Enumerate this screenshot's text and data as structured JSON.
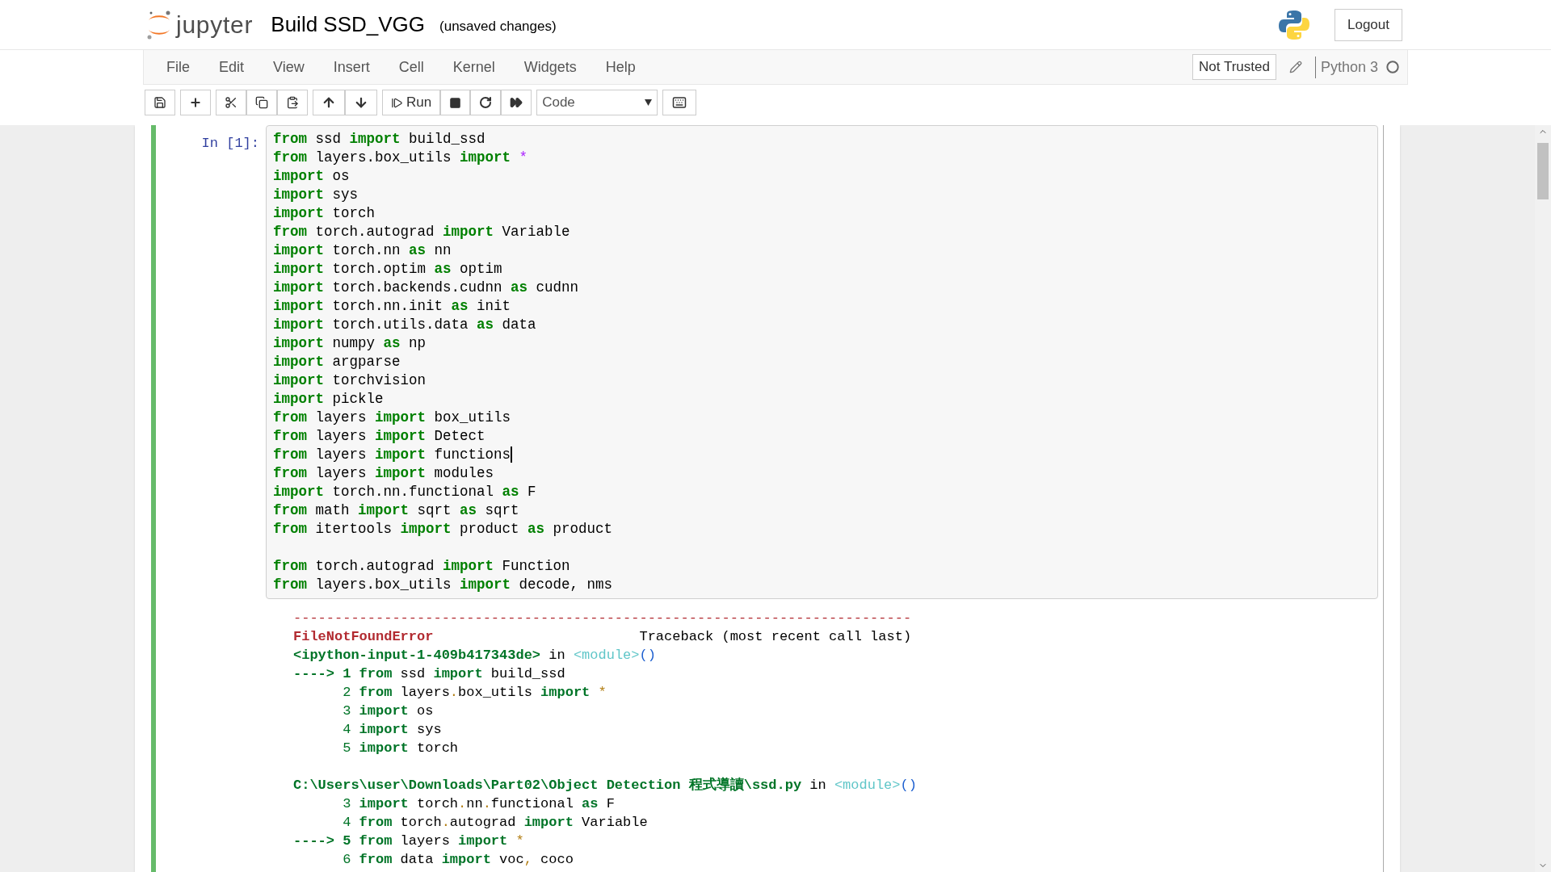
{
  "header": {
    "logo_text": "jupyter",
    "notebook_title": "Build SSD_VGG",
    "save_status": "(unsaved changes)",
    "logout": "Logout"
  },
  "menu": [
    "File",
    "Edit",
    "View",
    "Insert",
    "Cell",
    "Kernel",
    "Widgets",
    "Help"
  ],
  "trust": "Not Trusted",
  "kernel": "Python 3",
  "toolbar": {
    "run": "Run",
    "cell_type": "Code"
  },
  "cell": {
    "prompt": "In [1]:",
    "lines": [
      {
        "kind": "code",
        "cursor": false,
        "tokens": [
          {
            "kind": "kw",
            "text": "from"
          },
          {
            "kind": "t",
            "text": " ssd "
          },
          {
            "kind": "kw",
            "text": "import"
          },
          {
            "kind": "t",
            "text": " build_ssd"
          }
        ]
      },
      {
        "kind": "code",
        "cursor": false,
        "tokens": [
          {
            "kind": "kw",
            "text": "from"
          },
          {
            "kind": "t",
            "text": " layers.box_utils "
          },
          {
            "kind": "kw",
            "text": "import"
          },
          {
            "kind": "op",
            "text": " *"
          }
        ]
      },
      {
        "kind": "code",
        "cursor": false,
        "tokens": [
          {
            "kind": "kw",
            "text": "import"
          },
          {
            "kind": "t",
            "text": " os"
          }
        ]
      },
      {
        "kind": "code",
        "cursor": false,
        "tokens": [
          {
            "kind": "kw",
            "text": "import"
          },
          {
            "kind": "t",
            "text": " sys"
          }
        ]
      },
      {
        "kind": "code",
        "cursor": false,
        "tokens": [
          {
            "kind": "kw",
            "text": "import"
          },
          {
            "kind": "t",
            "text": " torch"
          }
        ]
      },
      {
        "kind": "code",
        "cursor": false,
        "tokens": [
          {
            "kind": "kw",
            "text": "from"
          },
          {
            "kind": "t",
            "text": " torch.autograd "
          },
          {
            "kind": "kw",
            "text": "import"
          },
          {
            "kind": "t",
            "text": " Variable"
          }
        ]
      },
      {
        "kind": "code",
        "cursor": false,
        "tokens": [
          {
            "kind": "kw",
            "text": "import"
          },
          {
            "kind": "t",
            "text": " torch.nn "
          },
          {
            "kind": "kw",
            "text": "as"
          },
          {
            "kind": "t",
            "text": " nn"
          }
        ]
      },
      {
        "kind": "code",
        "cursor": false,
        "tokens": [
          {
            "kind": "kw",
            "text": "import"
          },
          {
            "kind": "t",
            "text": " torch.optim "
          },
          {
            "kind": "kw",
            "text": "as"
          },
          {
            "kind": "t",
            "text": " optim"
          }
        ]
      },
      {
        "kind": "code",
        "cursor": false,
        "tokens": [
          {
            "kind": "kw",
            "text": "import"
          },
          {
            "kind": "t",
            "text": " torch.backends.cudnn "
          },
          {
            "kind": "kw",
            "text": "as"
          },
          {
            "kind": "t",
            "text": " cudnn"
          }
        ]
      },
      {
        "kind": "code",
        "cursor": false,
        "tokens": [
          {
            "kind": "kw",
            "text": "import"
          },
          {
            "kind": "t",
            "text": " torch.nn.init "
          },
          {
            "kind": "kw",
            "text": "as"
          },
          {
            "kind": "t",
            "text": " init"
          }
        ]
      },
      {
        "kind": "code",
        "cursor": false,
        "tokens": [
          {
            "kind": "kw",
            "text": "import"
          },
          {
            "kind": "t",
            "text": " torch.utils.data "
          },
          {
            "kind": "kw",
            "text": "as"
          },
          {
            "kind": "t",
            "text": " data"
          }
        ]
      },
      {
        "kind": "code",
        "cursor": false,
        "tokens": [
          {
            "kind": "kw",
            "text": "import"
          },
          {
            "kind": "t",
            "text": " numpy "
          },
          {
            "kind": "kw",
            "text": "as"
          },
          {
            "kind": "t",
            "text": " np"
          }
        ]
      },
      {
        "kind": "code",
        "cursor": false,
        "tokens": [
          {
            "kind": "kw",
            "text": "import"
          },
          {
            "kind": "t",
            "text": " argparse"
          }
        ]
      },
      {
        "kind": "code",
        "cursor": false,
        "tokens": [
          {
            "kind": "kw",
            "text": "import"
          },
          {
            "kind": "t",
            "text": " torchvision"
          }
        ]
      },
      {
        "kind": "code",
        "cursor": false,
        "tokens": [
          {
            "kind": "kw",
            "text": "import"
          },
          {
            "kind": "t",
            "text": " pickle"
          }
        ]
      },
      {
        "kind": "code",
        "cursor": false,
        "tokens": [
          {
            "kind": "kw",
            "text": "from"
          },
          {
            "kind": "t",
            "text": " layers "
          },
          {
            "kind": "kw",
            "text": "import"
          },
          {
            "kind": "t",
            "text": " box_utils"
          }
        ]
      },
      {
        "kind": "code",
        "cursor": false,
        "tokens": [
          {
            "kind": "kw",
            "text": "from"
          },
          {
            "kind": "t",
            "text": " layers "
          },
          {
            "kind": "kw",
            "text": "import"
          },
          {
            "kind": "t",
            "text": " Detect"
          }
        ]
      },
      {
        "kind": "code",
        "cursor": true,
        "tokens": [
          {
            "kind": "kw",
            "text": "from"
          },
          {
            "kind": "t",
            "text": " layers "
          },
          {
            "kind": "kw",
            "text": "import"
          },
          {
            "kind": "t",
            "text": " functions"
          }
        ]
      },
      {
        "kind": "code",
        "cursor": false,
        "tokens": [
          {
            "kind": "kw",
            "text": "from"
          },
          {
            "kind": "t",
            "text": " layers "
          },
          {
            "kind": "kw",
            "text": "import"
          },
          {
            "kind": "t",
            "text": " modules"
          }
        ]
      },
      {
        "kind": "code",
        "cursor": false,
        "tokens": [
          {
            "kind": "kw",
            "text": "import"
          },
          {
            "kind": "t",
            "text": " torch.nn.functional "
          },
          {
            "kind": "kw",
            "text": "as"
          },
          {
            "kind": "t",
            "text": " F"
          }
        ]
      },
      {
        "kind": "code",
        "cursor": false,
        "tokens": [
          {
            "kind": "kw",
            "text": "from"
          },
          {
            "kind": "t",
            "text": " math "
          },
          {
            "kind": "kw",
            "text": "import"
          },
          {
            "kind": "t",
            "text": " sqrt "
          },
          {
            "kind": "kw",
            "text": "as"
          },
          {
            "kind": "t",
            "text": " sqrt"
          }
        ]
      },
      {
        "kind": "code",
        "cursor": false,
        "tokens": [
          {
            "kind": "kw",
            "text": "from"
          },
          {
            "kind": "t",
            "text": " itertools "
          },
          {
            "kind": "kw",
            "text": "import"
          },
          {
            "kind": "t",
            "text": " product "
          },
          {
            "kind": "kw",
            "text": "as"
          },
          {
            "kind": "t",
            "text": " product"
          }
        ]
      },
      {
        "kind": "blank"
      },
      {
        "kind": "code",
        "cursor": false,
        "tokens": [
          {
            "kind": "kw",
            "text": "from"
          },
          {
            "kind": "t",
            "text": " torch.autograd "
          },
          {
            "kind": "kw",
            "text": "import"
          },
          {
            "kind": "t",
            "text": " Function"
          }
        ]
      },
      {
        "kind": "code",
        "cursor": false,
        "tokens": [
          {
            "kind": "kw",
            "text": "from"
          },
          {
            "kind": "t",
            "text": " layers.box_utils "
          },
          {
            "kind": "kw",
            "text": "import"
          },
          {
            "kind": "t",
            "text": " decode, nms"
          }
        ]
      }
    ],
    "output": [
      {
        "kind": "rule",
        "text": "---------------------------------------------------------------------------"
      },
      {
        "kind": "header",
        "error": "FileNotFoundError",
        "traceback": "Traceback (most recent call last)"
      },
      {
        "kind": "code",
        "tokens": [
          {
            "kind": "g",
            "text": "<ipython-input-1-409b417343de>"
          },
          {
            "kind": "t",
            "text": " in "
          },
          {
            "kind": "mod",
            "text": "<module>"
          },
          {
            "kind": "paren",
            "text": "()"
          }
        ]
      },
      {
        "kind": "code",
        "tokens": [
          {
            "kind": "arrow",
            "text": "----> 1"
          },
          {
            "kind": "kw",
            "text": " from"
          },
          {
            "kind": "t",
            "text": " ssd "
          },
          {
            "kind": "kw",
            "text": "import"
          },
          {
            "kind": "t",
            "text": " build_ssd"
          }
        ]
      },
      {
        "kind": "code",
        "tokens": [
          {
            "kind": "ln",
            "text": "2"
          },
          {
            "kind": "kw",
            "text": " from"
          },
          {
            "kind": "t",
            "text": " layers"
          },
          {
            "kind": "op",
            "text": "."
          },
          {
            "kind": "t",
            "text": "box_utils "
          },
          {
            "kind": "kw",
            "text": "import"
          },
          {
            "kind": "op",
            "text": " *"
          }
        ]
      },
      {
        "kind": "code",
        "tokens": [
          {
            "kind": "ln",
            "text": "3"
          },
          {
            "kind": "kw",
            "text": " import"
          },
          {
            "kind": "t",
            "text": " os"
          }
        ]
      },
      {
        "kind": "code",
        "tokens": [
          {
            "kind": "ln",
            "text": "4"
          },
          {
            "kind": "kw",
            "text": " import"
          },
          {
            "kind": "t",
            "text": " sys"
          }
        ]
      },
      {
        "kind": "code",
        "tokens": [
          {
            "kind": "ln",
            "text": "5"
          },
          {
            "kind": "kw",
            "text": " import"
          },
          {
            "kind": "t",
            "text": " torch"
          }
        ]
      },
      {
        "kind": "blank"
      },
      {
        "kind": "code",
        "tokens": [
          {
            "kind": "g",
            "text": "C:\\Users\\user\\Downloads\\Part02\\Object Detection 程式導讀\\ssd.py"
          },
          {
            "kind": "t",
            "text": " in "
          },
          {
            "kind": "mod",
            "text": "<module>"
          },
          {
            "kind": "paren",
            "text": "()"
          }
        ]
      },
      {
        "kind": "code",
        "tokens": [
          {
            "kind": "ln",
            "text": "3"
          },
          {
            "kind": "kw",
            "text": " import"
          },
          {
            "kind": "t",
            "text": " torch"
          },
          {
            "kind": "op",
            "text": "."
          },
          {
            "kind": "t",
            "text": "nn"
          },
          {
            "kind": "op",
            "text": "."
          },
          {
            "kind": "t",
            "text": "functional "
          },
          {
            "kind": "kw",
            "text": "as"
          },
          {
            "kind": "t",
            "text": " F"
          }
        ]
      },
      {
        "kind": "code",
        "tokens": [
          {
            "kind": "ln",
            "text": "4"
          },
          {
            "kind": "kw",
            "text": " from"
          },
          {
            "kind": "t",
            "text": " torch"
          },
          {
            "kind": "op",
            "text": "."
          },
          {
            "kind": "t",
            "text": "autograd "
          },
          {
            "kind": "kw",
            "text": "import"
          },
          {
            "kind": "t",
            "text": " Variable"
          }
        ]
      },
      {
        "kind": "code",
        "tokens": [
          {
            "kind": "arrow",
            "text": "----> 5"
          },
          {
            "kind": "kw",
            "text": " from"
          },
          {
            "kind": "t",
            "text": " layers "
          },
          {
            "kind": "kw",
            "text": "import"
          },
          {
            "kind": "op",
            "text": " *"
          }
        ]
      },
      {
        "kind": "code",
        "tokens": [
          {
            "kind": "ln",
            "text": "6"
          },
          {
            "kind": "kw",
            "text": " from"
          },
          {
            "kind": "t",
            "text": " data "
          },
          {
            "kind": "kw",
            "text": "import"
          },
          {
            "kind": "t",
            "text": " voc"
          },
          {
            "kind": "op",
            "text": ","
          },
          {
            "kind": "t",
            "text": " coco"
          }
        ]
      }
    ]
  }
}
